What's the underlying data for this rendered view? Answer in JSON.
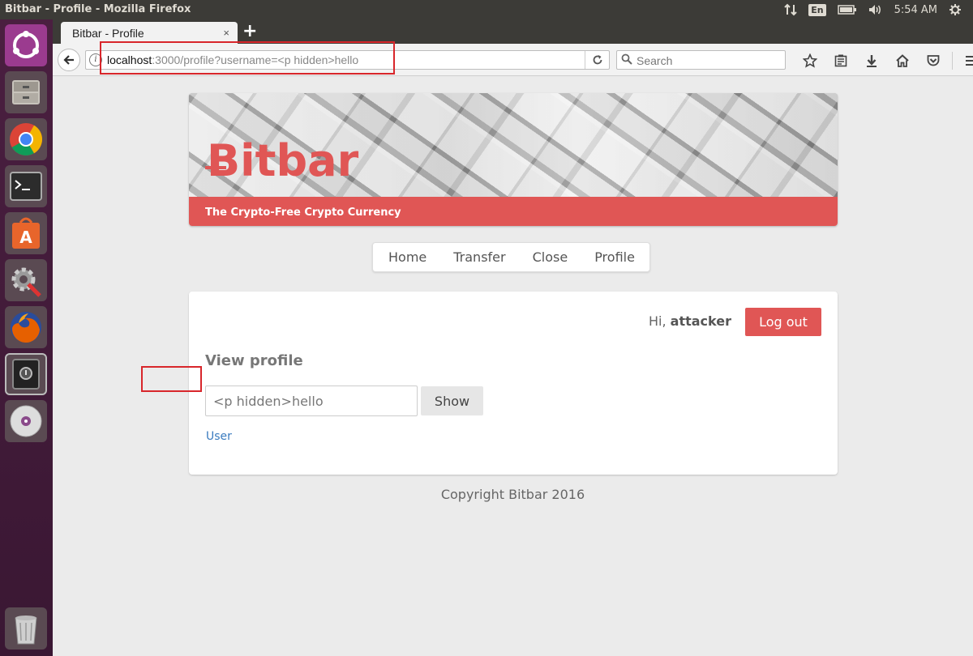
{
  "system": {
    "window_title": "Bitbar - Profile - Mozilla Firefox",
    "lang": "En",
    "clock": "5:54 AM"
  },
  "launcher": {
    "icons": [
      "ubuntu-dash-icon",
      "files-icon",
      "chrome-icon",
      "terminal-icon",
      "software-center-icon",
      "system-settings-icon",
      "firefox-icon",
      "security-app-icon",
      "dvd-icon",
      "trash-icon"
    ]
  },
  "browser": {
    "tab_title": "Bitbar - Profile",
    "tab_close": "×",
    "new_tab": "+",
    "url_host": "localhost",
    "url_rest": ":3000/profile?username=<p hidden>hello",
    "search_placeholder": "Search"
  },
  "page": {
    "brand": "Bitbar",
    "tagline": "The Crypto-Free Crypto Currency",
    "nav": [
      "Home",
      "Transfer",
      "Close",
      "Profile"
    ],
    "greeting_prefix": "Hi, ",
    "username": "attacker",
    "logout_label": "Log out",
    "view_title": "View profile",
    "input_value": "<p hidden>hello",
    "show_label": "Show",
    "user_link": "User",
    "footer": "Copyright Bitbar 2016"
  },
  "colors": {
    "brand_red": "#e05655",
    "highlight_red": "#d8262b",
    "link_blue": "#3a7bbf"
  }
}
